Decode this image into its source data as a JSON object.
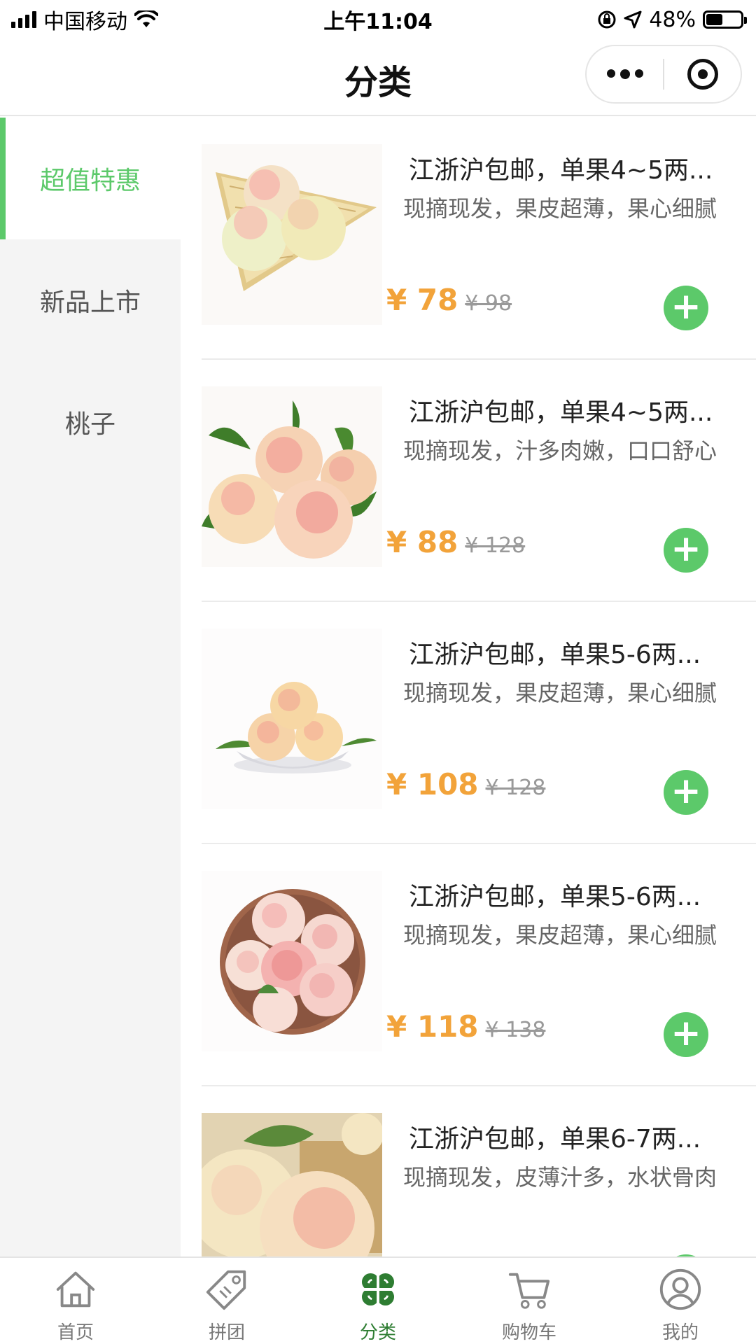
{
  "status_bar": {
    "carrier": "中国移动",
    "time": "上午11:04",
    "battery": "48%",
    "battery_level": 0.48
  },
  "nav": {
    "title": "分类",
    "more_icon": "more-dots-icon",
    "close_icon": "target-icon"
  },
  "sidebar": {
    "items": [
      {
        "label": "超值特惠",
        "active": true
      },
      {
        "label": "新品上市",
        "active": false
      },
      {
        "label": "桃子",
        "active": false
      }
    ]
  },
  "products": [
    {
      "title": "江浙沪包邮，单果4~5两...",
      "desc": "现摘现发，果皮超薄，果心细腻",
      "price": "¥ 78",
      "original_price": "¥ 98"
    },
    {
      "title": "江浙沪包邮，单果4~5两...",
      "desc": "现摘现发，汁多肉嫩，口口舒心",
      "price": "¥ 88",
      "original_price": "¥ 128"
    },
    {
      "title": "江浙沪包邮，单果5-6两...",
      "desc": "现摘现发，果皮超薄，果心细腻",
      "price": "¥ 108",
      "original_price": "¥ 128"
    },
    {
      "title": "江浙沪包邮，单果5-6两...",
      "desc": "现摘现发，果皮超薄，果心细腻",
      "price": "¥ 118",
      "original_price": "¥ 138"
    },
    {
      "title": "江浙沪包邮，单果6-7两...",
      "desc": "现摘现发，皮薄汁多，水状骨肉",
      "price": "",
      "original_price": ""
    }
  ],
  "tabbar": {
    "items": [
      {
        "label": "首页",
        "icon": "home-icon",
        "active": false
      },
      {
        "label": "拼团",
        "icon": "tag-icon",
        "active": false
      },
      {
        "label": "分类",
        "icon": "category-icon",
        "active": true
      },
      {
        "label": "购物车",
        "icon": "cart-icon",
        "active": false
      },
      {
        "label": "我的",
        "icon": "user-icon",
        "active": false
      }
    ]
  },
  "colors": {
    "accent_green": "#5cc96a",
    "price_orange": "#f2a33a",
    "tab_active": "#2e7d32"
  }
}
